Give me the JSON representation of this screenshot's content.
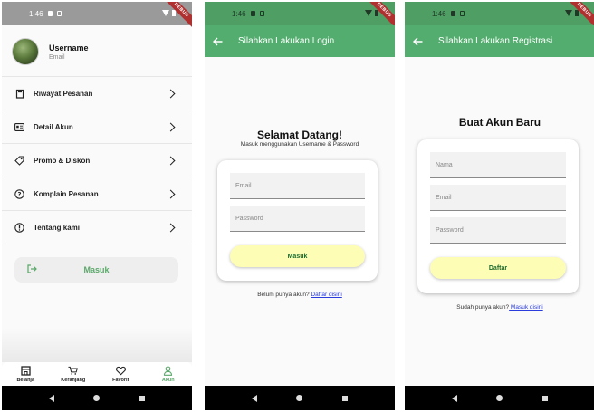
{
  "status_time": "1:46",
  "debug_label": "DEBUG",
  "account_screen": {
    "profile": {
      "name": "Username",
      "email": "Email"
    },
    "menu": [
      {
        "label": "Riwayat Pesanan",
        "icon": "receipt-icon"
      },
      {
        "label": "Detail Akun",
        "icon": "id-card-icon"
      },
      {
        "label": "Promo & Diskon",
        "icon": "tag-icon"
      },
      {
        "label": "Komplain Pesanan",
        "icon": "question-icon"
      },
      {
        "label": "Tentang kami",
        "icon": "info-icon"
      }
    ],
    "login_label": "Masuk",
    "bottom_nav": [
      {
        "label": "Belanja",
        "icon": "store-icon",
        "active": false
      },
      {
        "label": "Keranjang",
        "icon": "cart-icon",
        "active": false
      },
      {
        "label": "Favorit",
        "icon": "heart-icon",
        "active": false
      },
      {
        "label": "Akun",
        "icon": "person-icon",
        "active": true
      }
    ]
  },
  "login_screen": {
    "appbar_title": "Silahkan Lakukan Login",
    "heading": "Selamat Datang!",
    "subheading": "Masuk menggunakan Username & Password",
    "email_placeholder": "Email",
    "password_placeholder": "Password",
    "button_label": "Masuk",
    "footer_text": "Belum punya akun? ",
    "footer_link": "Daftar disini"
  },
  "register_screen": {
    "appbar_title": "Silahkan Lakukan Registrasi",
    "heading": "Buat Akun Baru",
    "name_placeholder": "Nama",
    "email_placeholder": "Email",
    "password_placeholder": "Password",
    "button_label": "Daftar",
    "footer_text": "Sudah punya akun?",
    "footer_link": " Masuk disini"
  },
  "colors": {
    "primary_green": "#52ad6e",
    "button_yellow": "#fdfdb6",
    "link_blue": "#2a3ddc",
    "debug_red": "#b03030"
  }
}
